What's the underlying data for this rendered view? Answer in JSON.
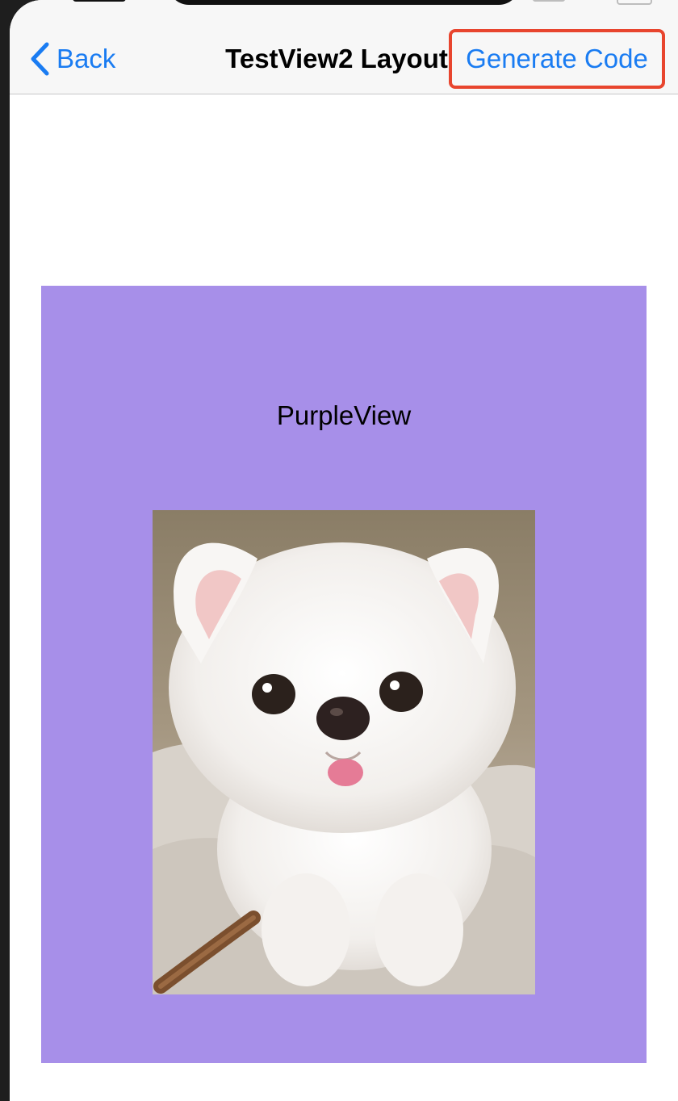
{
  "nav": {
    "back_label": "Back",
    "title": "TestView2 Layout",
    "generate_label": "Generate Code"
  },
  "content": {
    "purple_label": "PurpleView",
    "image_icon": "puppy-photo"
  },
  "colors": {
    "accent": "#1a7cf2",
    "highlight_border": "#e8452e",
    "purple": "#a78fe9",
    "nav_background": "#f7f7f7"
  }
}
